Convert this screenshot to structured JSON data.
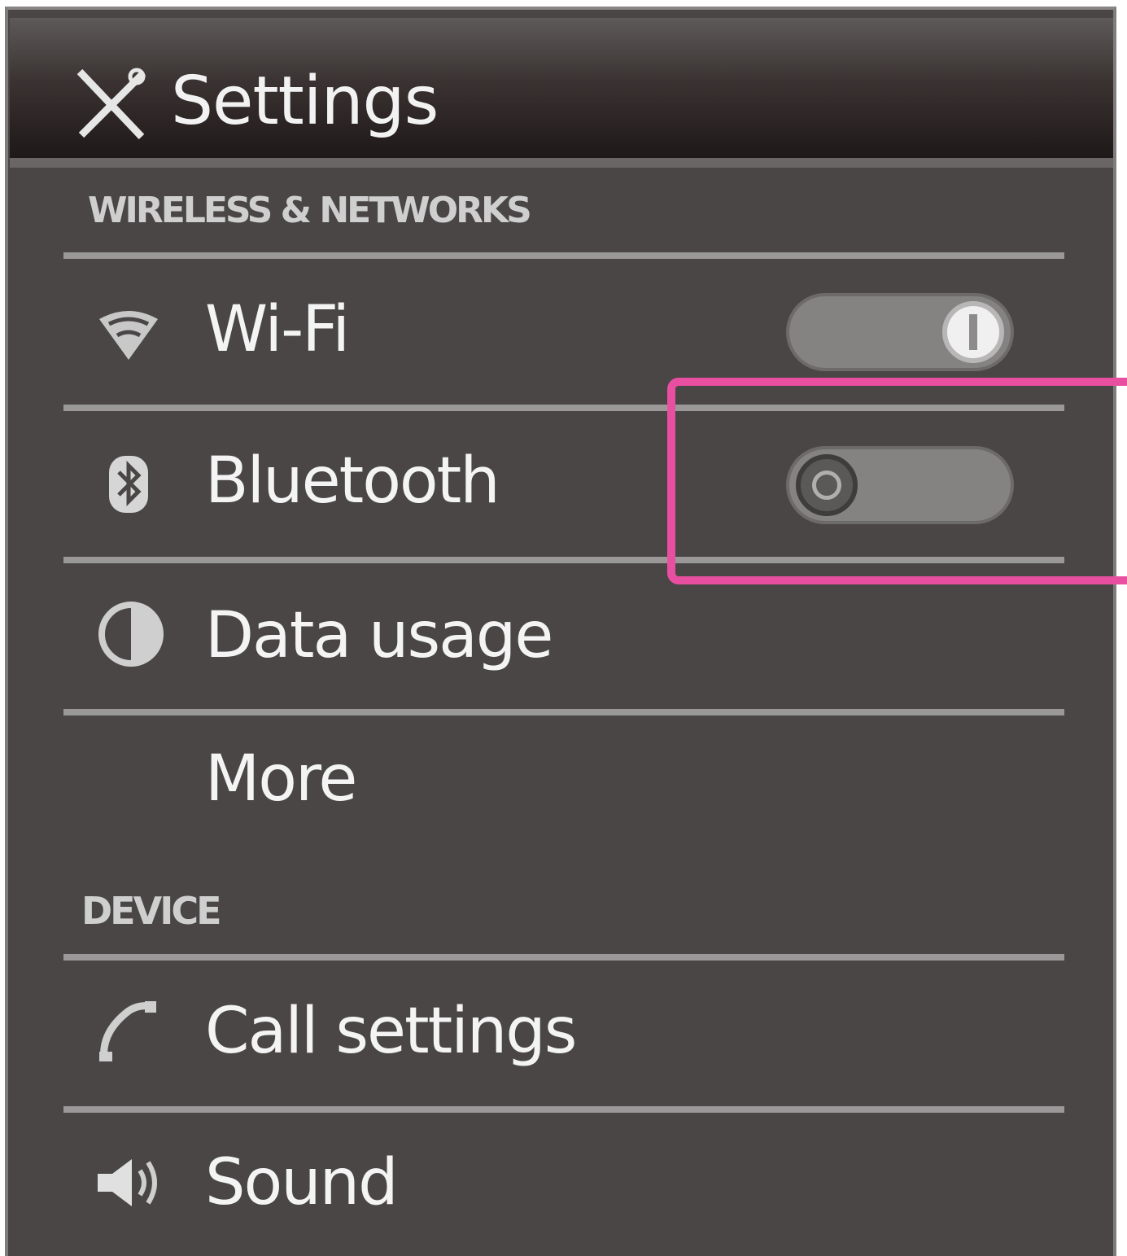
{
  "header": {
    "title": "Settings",
    "icon": "tools-icon"
  },
  "sections": {
    "wireless": "WIRELESS & NETWORKS",
    "device": "DEVICE"
  },
  "rows": {
    "wifi": {
      "label": "Wi-Fi",
      "icon": "wifi-icon",
      "toggle": "on"
    },
    "bluetooth": {
      "label": "Bluetooth",
      "icon": "bluetooth-icon",
      "toggle": "off"
    },
    "data_usage": {
      "label": "Data usage",
      "icon": "data-usage-icon"
    },
    "more": {
      "label": "More"
    },
    "call_settings": {
      "label": "Call settings",
      "icon": "phone-icon"
    },
    "sound": {
      "label": "Sound",
      "icon": "speaker-icon"
    }
  },
  "colors": {
    "background": "#4a4646",
    "header_dark": "#1f1818",
    "divider": "#9a9898",
    "highlight": "#e94fa0"
  }
}
